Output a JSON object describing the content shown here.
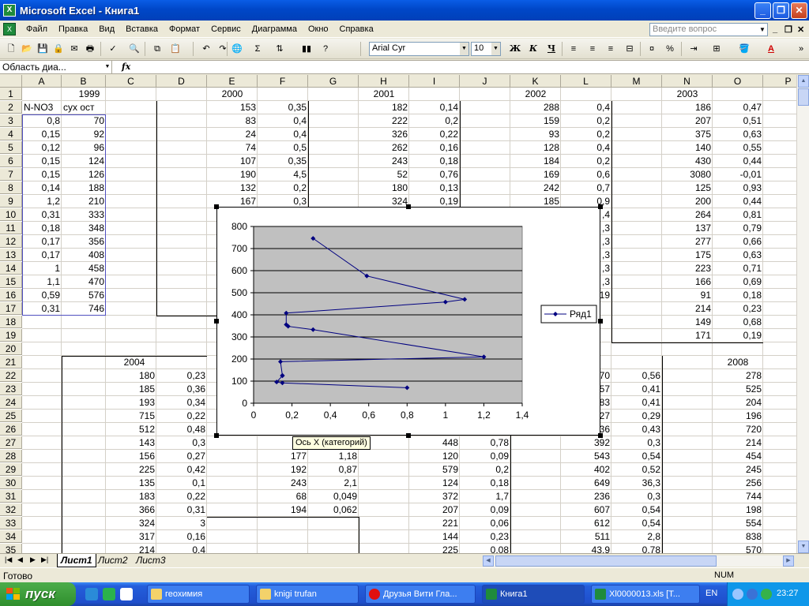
{
  "window": {
    "title": "Microsoft Excel - Книга1"
  },
  "window_controls": {
    "minimize": "_",
    "maximize": "❐",
    "close": "✕"
  },
  "menu": {
    "items": [
      "Файл",
      "Правка",
      "Вид",
      "Вставка",
      "Формат",
      "Сервис",
      "Диаграмма",
      "Окно",
      "Справка"
    ],
    "help_placeholder": "Введите вопрос",
    "doc_controls": [
      "_",
      "❐",
      "✕"
    ]
  },
  "toolbar": {
    "font_name": "Arial Cyr",
    "font_size": "10",
    "bold": "Ж",
    "italic": "К",
    "underline": "Ч",
    "sigma": "Σ",
    "percent": "%",
    "font_color_glyph": "A"
  },
  "formula_bar": {
    "name_box": "Область диа...",
    "fx": "fx"
  },
  "columns": [
    "A",
    "B",
    "C",
    "D",
    "E",
    "F",
    "G",
    "H",
    "I",
    "J",
    "K",
    "L",
    "M",
    "N",
    "O",
    "P"
  ],
  "rows": [
    "1",
    "2",
    "3",
    "4",
    "5",
    "6",
    "7",
    "8",
    "9",
    "10",
    "11",
    "12",
    "13",
    "14",
    "15",
    "16",
    "17",
    "18",
    "19",
    "20",
    "21",
    "22",
    "23",
    "24",
    "25",
    "26",
    "27",
    "28",
    "29",
    "30",
    "31",
    "32",
    "33",
    "34",
    "35"
  ],
  "cells": {
    "B1": "1999",
    "E1": "2000",
    "H1": "2001",
    "K1": "2002",
    "N1": "2003",
    "A2": "N-NO3",
    "B2": "сух ост",
    "A3": "0,8",
    "B3": "70",
    "A4": "0,15",
    "B4": "92",
    "A5": "0,12",
    "B5": "96",
    "A6": "0,15",
    "B6": "124",
    "A7": "0,15",
    "B7": "126",
    "A8": "0,14",
    "B8": "188",
    "A9": "1,2",
    "B9": "210",
    "A10": "0,31",
    "B10": "333",
    "A11": "0,18",
    "B11": "348",
    "A12": "0,17",
    "B12": "356",
    "A13": "0,17",
    "B13": "408",
    "A14": "1",
    "B14": "458",
    "A15": "1,1",
    "B15": "470",
    "A16": "0,59",
    "B16": "576",
    "A17": "0,31",
    "B17": "746",
    "E2": "153",
    "F2": "0,35",
    "E3": "83",
    "F3": "0,4",
    "E4": "24",
    "F4": "0,4",
    "E5": "74",
    "F5": "0,5",
    "E6": "107",
    "F6": "0,35",
    "E7": "190",
    "F7": "4,5",
    "E8": "132",
    "F8": "0,2",
    "E9": "167",
    "F9": "0,3",
    "H2": "182",
    "I2": "0,14",
    "H3": "222",
    "I3": "0,2",
    "H4": "326",
    "I4": "0,22",
    "H5": "262",
    "I5": "0,16",
    "H6": "243",
    "I6": "0,18",
    "H7": "52",
    "I7": "0,76",
    "H8": "180",
    "I8": "0,13",
    "H9": "324",
    "I9": "0,19",
    "K2": "288",
    "L2": "0,4",
    "K3": "159",
    "L3": "0,2",
    "K4": "93",
    "L4": "0,2",
    "K5": "128",
    "L5": "0,4",
    "K6": "184",
    "L6": "0,2",
    "K7": "169",
    "L7": "0,6",
    "K8": "242",
    "L8": "0,7",
    "K9": "185",
    "L9": "0,9",
    "L10": ",4",
    "L11": ",3",
    "L12": ",3",
    "L13": ",3",
    "L14": ",3",
    "L15": ",3",
    "L16": "19",
    "N2": "186",
    "O2": "0,47",
    "N3": "207",
    "O3": "0,51",
    "N4": "375",
    "O4": "0,63",
    "N5": "140",
    "O5": "0,55",
    "N6": "430",
    "O6": "0,44",
    "N7": "3080",
    "O7": "-0,01",
    "N8": "125",
    "O8": "0,93",
    "N9": "200",
    "O9": "0,44",
    "N10": "264",
    "O10": "0,81",
    "N11": "137",
    "O11": "0,79",
    "N12": "277",
    "O12": "0,66",
    "N13": "175",
    "O13": "0,63",
    "N14": "223",
    "O14": "0,71",
    "N15": "166",
    "O15": "0,69",
    "N16": "91",
    "O16": "0,18",
    "N17": "214",
    "O17": "0,23",
    "N18": "149",
    "O18": "0,68",
    "N19": "171",
    "O19": "0,19",
    "C21": "2004",
    "O21": "2008",
    "C22": "180",
    "D22": "0,23",
    "C23": "185",
    "D23": "0,36",
    "C24": "193",
    "D24": "0,34",
    "C25": "715",
    "D25": "0,22",
    "C26": "512",
    "D26": "0,48",
    "C27": "143",
    "D27": "0,3",
    "C28": "156",
    "D28": "0,27",
    "C29": "225",
    "D29": "0,42",
    "C30": "135",
    "D30": "0,1",
    "C31": "183",
    "D31": "0,22",
    "C32": "366",
    "D32": "0,31",
    "C33": "324",
    "D33": "3",
    "C34": "317",
    "D34": "0,16",
    "C35": "214",
    "D35": "0,4",
    "F28": "177",
    "G28": "1,18",
    "F29": "192",
    "G29": "0,87",
    "F30": "243",
    "G30": "2,1",
    "F31": "68",
    "G31": "0,049",
    "F32": "194",
    "G32": "0,062",
    "I27": "448",
    "J27": "0,78",
    "I28": "120",
    "J28": "0,09",
    "I29": "579",
    "J29": "0,2",
    "I30": "124",
    "J30": "0,18",
    "I31": "372",
    "J31": "1,7",
    "I32": "207",
    "J32": "0,09",
    "I33": "221",
    "J33": "0,06",
    "I34": "144",
    "J34": "0,23",
    "I35": "225",
    "J35": "0,08",
    "L22": "70",
    "M22": "0,56",
    "L23": "57",
    "M23": "0,41",
    "L24": "83",
    "M24": "0,41",
    "L25": "27",
    "M25": "0,29",
    "L26": "36",
    "M26": "0,43",
    "L27": "392",
    "M27": "0,3",
    "L28": "543",
    "M28": "0,54",
    "L29": "402",
    "M29": "0,52",
    "L30": "649",
    "M30": "36,3",
    "L31": "236",
    "M31": "0,3",
    "L32": "607",
    "M32": "0,54",
    "L33": "612",
    "M33": "0,54",
    "L34": "511",
    "M34": "2,8",
    "L35": "43,9",
    "M35": "0,78",
    "O22": "278",
    "O23": "525",
    "O24": "204",
    "O25": "196",
    "O26": "720",
    "O27": "214",
    "O28": "454",
    "O29": "245",
    "O30": "256",
    "O31": "744",
    "O32": "198",
    "O33": "554",
    "O34": "838",
    "O35": "570"
  },
  "chart_data": {
    "type": "scatter",
    "title": "",
    "xlabel": "",
    "ylabel": "",
    "xlim": [
      0,
      1.4
    ],
    "ylim": [
      0,
      800
    ],
    "x_ticks": [
      "0",
      "0,2",
      "0,4",
      "0,6",
      "0,8",
      "1",
      "1,2",
      "1,4"
    ],
    "y_ticks": [
      "0",
      "100",
      "200",
      "300",
      "400",
      "500",
      "600",
      "700",
      "800"
    ],
    "grid": true,
    "legend_position": "right",
    "plot_area_color": "#c0c0c0",
    "series_color": "#000080",
    "series": [
      {
        "name": "Ряд1",
        "x": [
          0.8,
          0.15,
          0.12,
          0.15,
          0.15,
          0.14,
          1.2,
          0.31,
          0.18,
          0.17,
          0.17,
          1,
          1.1,
          0.59,
          0.31
        ],
        "y": [
          70,
          92,
          96,
          124,
          126,
          188,
          210,
          333,
          348,
          356,
          408,
          458,
          470,
          576,
          746
        ]
      }
    ]
  },
  "chart_tooltip": "Ось X (категорий)",
  "sheet_tabs": [
    "Лист1",
    "Лист2",
    "Лист3"
  ],
  "status": {
    "ready": "Готово",
    "num": "NUM"
  },
  "taskbar": {
    "start": "пуск",
    "tasks": [
      "геохимия",
      "knigi trufan",
      "Друзья Вити Гла...",
      "Книга1",
      "Xl0000013.xls  [T..."
    ],
    "lang": "EN",
    "clock": "23:27"
  }
}
